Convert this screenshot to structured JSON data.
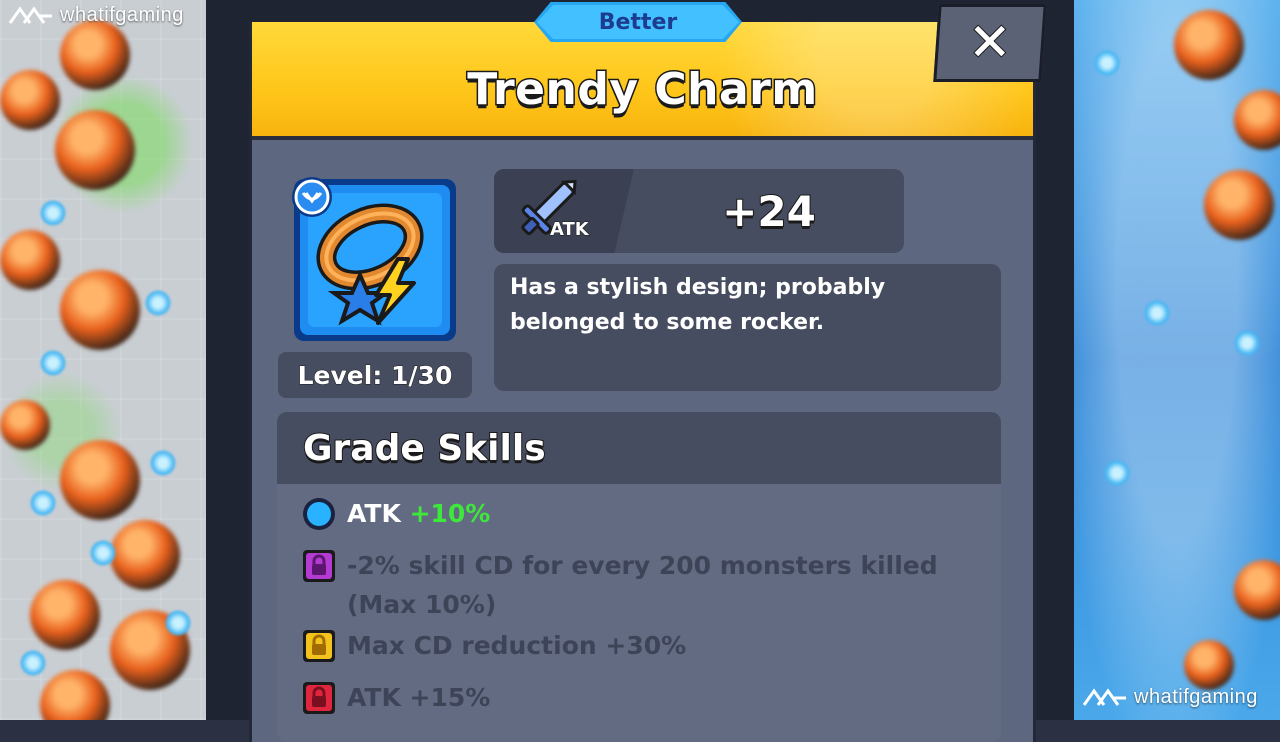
{
  "watermark": {
    "left": "whatifgaming",
    "right": "whatifgaming"
  },
  "dialog": {
    "rank_label": "Better",
    "title": "Trendy Charm",
    "close_symbol": "✕",
    "item": {
      "icon": "charm-bracelet-icon",
      "level_text": "Level: 1/30"
    },
    "stat": {
      "icon": "sword-icon",
      "icon_label": "ATK",
      "value": "+24"
    },
    "description_lines": [
      "Has a stylish design; probably",
      "belonged to some rocker."
    ]
  },
  "grade_skills": {
    "heading": "Grade Skills",
    "items": [
      {
        "state": "active",
        "icon": "blue-circle-icon",
        "name": "ATK",
        "bonus": "+10%"
      },
      {
        "state": "locked",
        "icon": "purple-lock-icon",
        "line1": "-2% skill CD for every 200 monsters killed",
        "line2": "(Max 10%)"
      },
      {
        "state": "locked",
        "icon": "yellow-lock-icon",
        "line1": "Max CD reduction +30%"
      },
      {
        "state": "locked",
        "icon": "red-lock-icon",
        "line1": "ATK +15%"
      }
    ]
  },
  "colors": {
    "header_yellow": "#ffc61a",
    "panel": "#5e6780",
    "bonus_green": "#3ee83a",
    "rank_blue": "#43c0ff",
    "lock_purple": "#b33bd1",
    "lock_yellow": "#f3c21c",
    "lock_red": "#e0253e"
  }
}
